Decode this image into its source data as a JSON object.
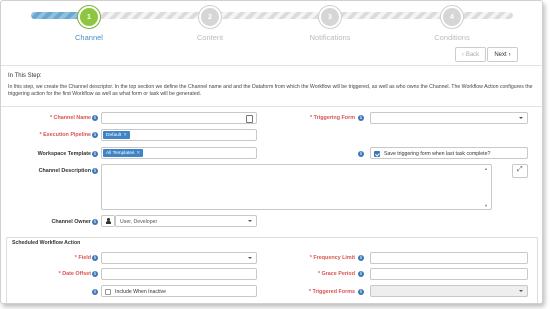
{
  "wizard": {
    "steps": [
      {
        "number": "1",
        "label": "Channel",
        "active": true
      },
      {
        "number": "2",
        "label": "Content",
        "active": false
      },
      {
        "number": "3",
        "label": "Notifications",
        "active": false
      },
      {
        "number": "4",
        "label": "Conditions",
        "active": false
      }
    ],
    "back_label": "Back",
    "next_label": "Next"
  },
  "info": {
    "title": "In This Step:",
    "text": "In this step, we create the Channel descriptor. In the top section we define the Channel name and and the Dataform from which the Workflow will be triggered, as well as who owns the Channel. The Workflow Action configures the triggering action for the first Workflow as well as what form or task will be generated."
  },
  "form": {
    "channel_name_label": "Channel Name",
    "execution_pipeline_label": "Execution Pipeline",
    "execution_pipeline_value": "Default",
    "workspace_template_label": "Workspace Template",
    "workspace_template_value": "All Templates",
    "channel_description_label": "Channel Description",
    "channel_owner_label": "Channel Owner",
    "channel_owner_value": "User, Developer",
    "triggering_form_label": "Triggering Form",
    "save_triggering_label": "Save triggering form when last task complete?",
    "save_triggering_checked": true
  },
  "scheduled": {
    "title": "Scheduled Workflow Action",
    "field_label": "Field",
    "date_offset_label": "Date Offset",
    "include_inactive_label": "Include When Inactive",
    "frequency_limit_label": "Frequency Limit",
    "grace_period_label": "Grace Period",
    "triggered_forms_label": "Triggered Forms"
  },
  "colors": {
    "accent": "#3a78b8",
    "active_step": "#8dc63f",
    "required": "#d9534f"
  }
}
